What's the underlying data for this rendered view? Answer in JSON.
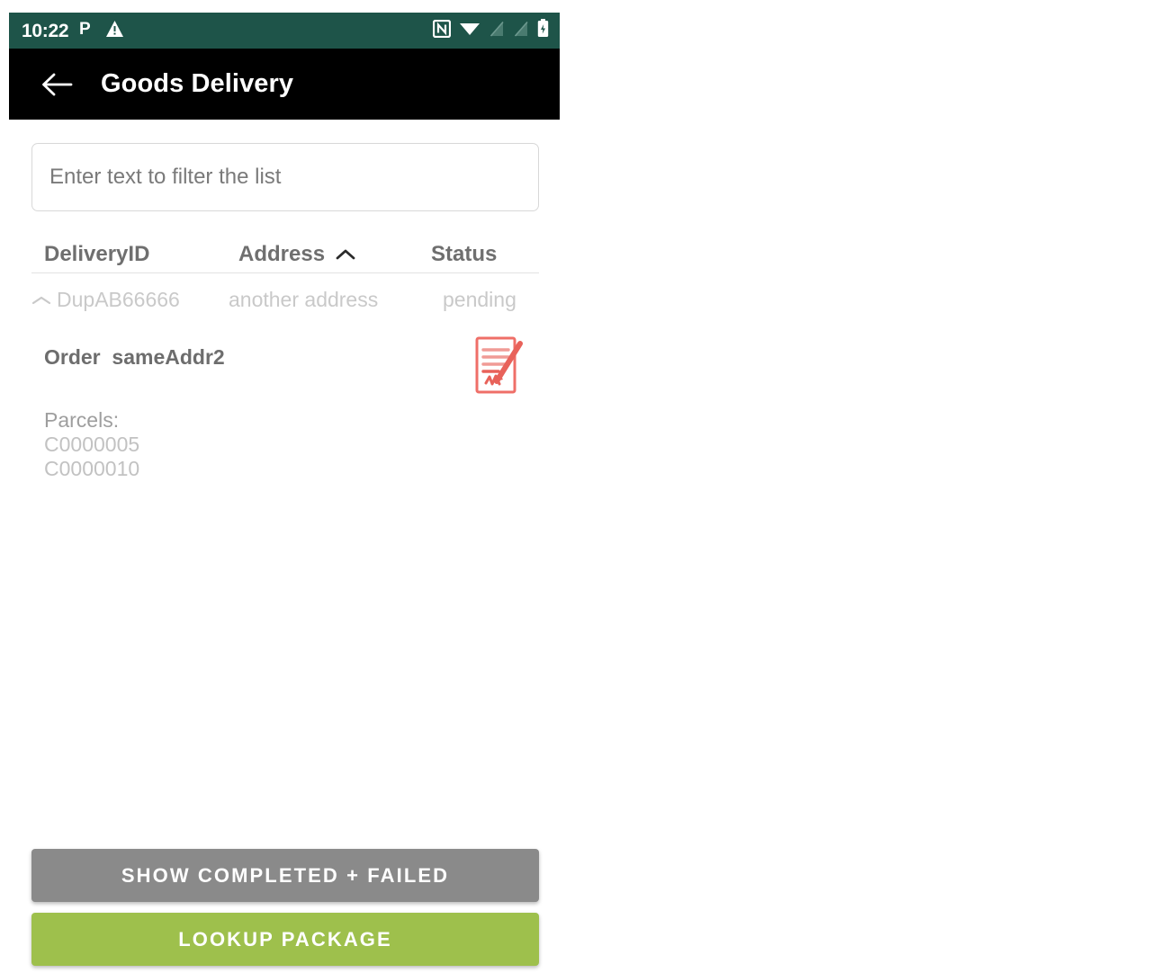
{
  "status_bar": {
    "time": "10:22",
    "left_icons": [
      "parking-p-icon",
      "warning-triangle-icon"
    ],
    "right_icons": [
      "nfc-icon",
      "wifi-icon",
      "signal-off-icon",
      "signal-off-icon",
      "battery-icon"
    ],
    "background_color": "#1e5449"
  },
  "app_bar": {
    "back_icon": "back-arrow-icon",
    "title": "Goods Delivery",
    "background_color": "#000000"
  },
  "filter": {
    "value": "",
    "placeholder": "Enter text to filter the list"
  },
  "table": {
    "columns": [
      {
        "label": "DeliveryID",
        "sorted": false
      },
      {
        "label": "Address",
        "sorted": true,
        "sort_icon": "caret-up-icon"
      },
      {
        "label": "Status",
        "sorted": false
      }
    ],
    "rows": [
      {
        "expand_icon": "chevron-up-icon",
        "delivery_id": "DupAB66666",
        "address": "another address",
        "status": "pending",
        "expanded": true
      }
    ]
  },
  "detail": {
    "order_line": "Order  sameAddr2",
    "signature_icon": "signed-document-icon",
    "signature_icon_color": "#e8625a",
    "parcels_label": "Parcels:",
    "parcels": [
      "C0000005",
      "C0000010"
    ]
  },
  "footer": {
    "show_completed_failed_label": "SHOW COMPLETED + FAILED",
    "show_completed_failed_color": "#8a8a8a",
    "lookup_package_label": "LOOKUP PACKAGE",
    "lookup_package_color": "#9ec04c"
  }
}
